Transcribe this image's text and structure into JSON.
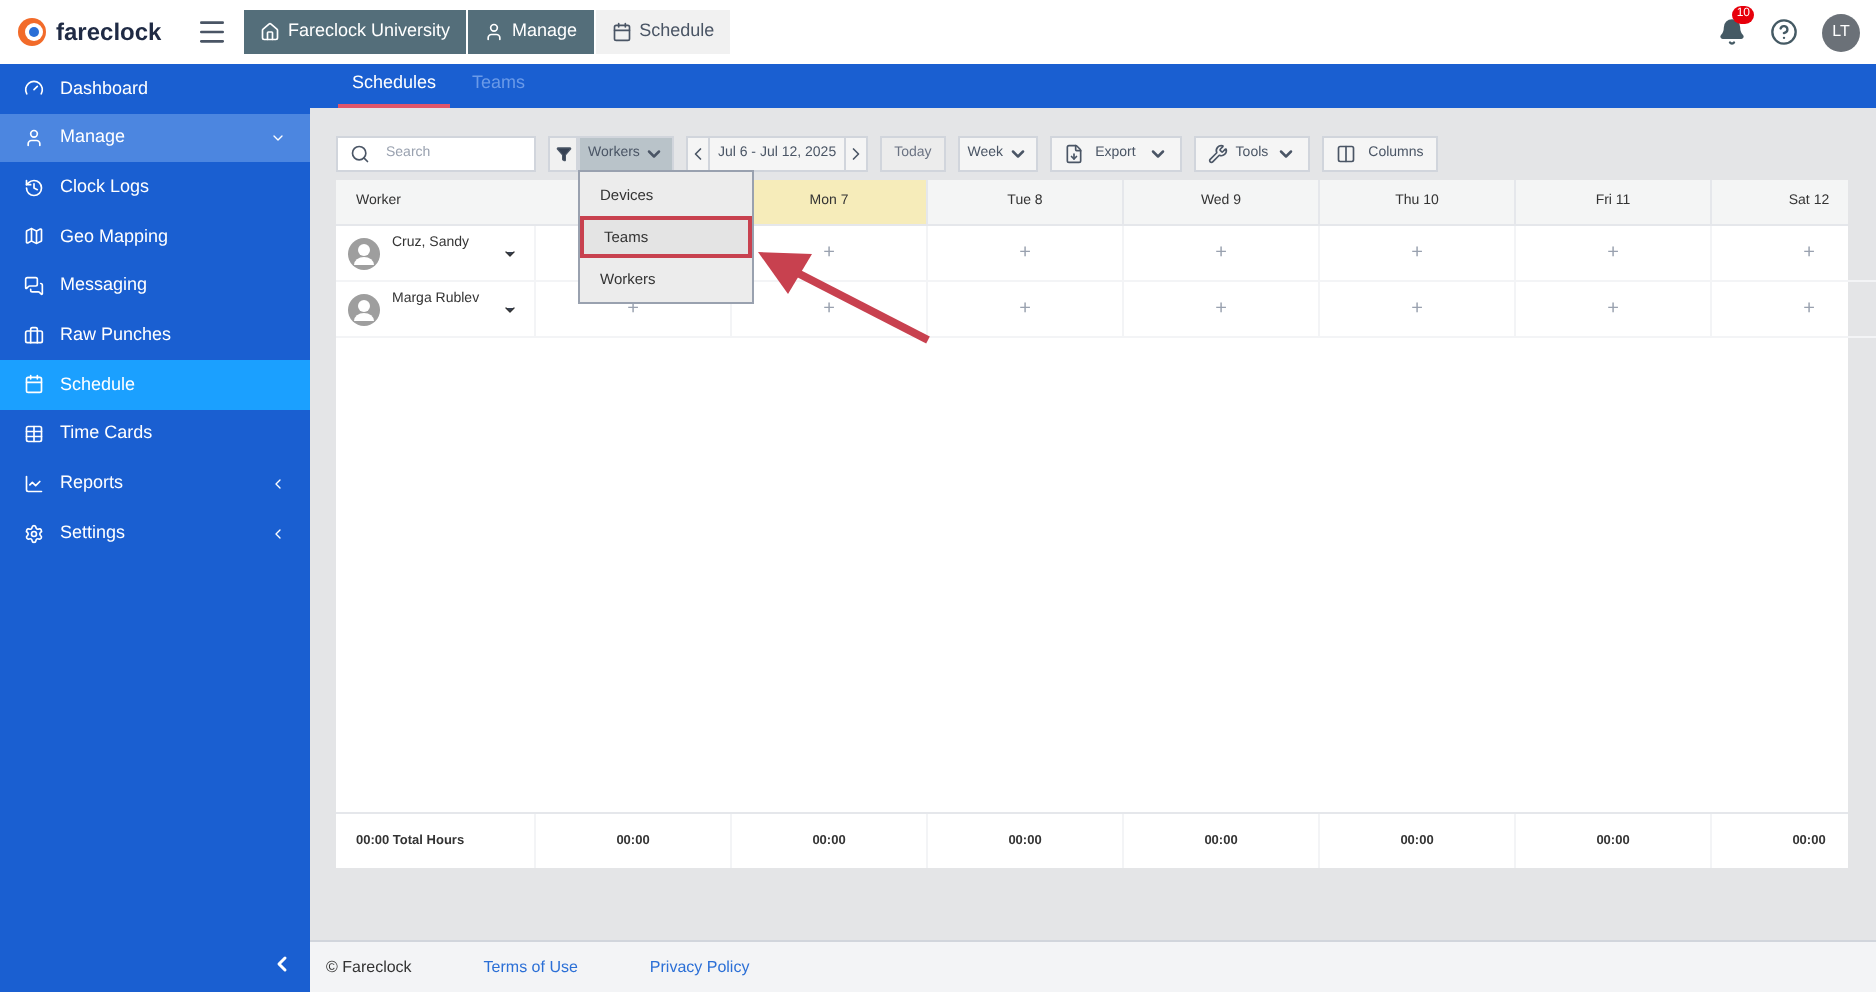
{
  "brand": "fareclock",
  "breadcrumbs": [
    {
      "label": "Fareclock University",
      "kind": "home"
    },
    {
      "label": "Manage",
      "kind": "user"
    },
    {
      "label": "Schedule",
      "kind": "calendar"
    }
  ],
  "notifications": {
    "count": "10"
  },
  "user": {
    "initials": "LT"
  },
  "sidebar": {
    "items": [
      {
        "label": "Dashboard",
        "kind": "link",
        "selected": false
      },
      {
        "label": "Manage",
        "kind": "submenu",
        "selected": false,
        "expanded": true
      },
      {
        "label": "Clock Logs",
        "kind": "link",
        "selected": false
      },
      {
        "label": "Geo Mapping",
        "kind": "link",
        "selected": false
      },
      {
        "label": "Messaging",
        "kind": "link",
        "selected": false
      },
      {
        "label": "Raw Punches",
        "kind": "link",
        "selected": false
      },
      {
        "label": "Schedule",
        "kind": "link",
        "selected": true
      },
      {
        "label": "Time Cards",
        "kind": "link",
        "selected": false
      },
      {
        "label": "Reports",
        "kind": "submenu",
        "selected": false,
        "expanded": false
      },
      {
        "label": "Settings",
        "kind": "submenu",
        "selected": false,
        "expanded": false
      }
    ]
  },
  "tabs": [
    {
      "label": "Schedules",
      "selected": true
    },
    {
      "label": "Teams",
      "selected": false
    }
  ],
  "toolbar": {
    "search_placeholder": "Search",
    "group_by": "Workers",
    "date_range": "Jul 6 - Jul 12, 2025",
    "today": "Today",
    "view": "Week",
    "export": "Export",
    "tools": "Tools",
    "columns": "Columns"
  },
  "group_menu": {
    "items": [
      {
        "label": "Devices",
        "selected": false
      },
      {
        "label": "Teams",
        "selected": true
      },
      {
        "label": "Workers",
        "selected": false
      }
    ]
  },
  "table": {
    "worker_header": "Worker",
    "days": [
      {
        "label": "Mon 7",
        "today": true
      },
      {
        "label": "Tue 8",
        "today": false
      },
      {
        "label": "Wed 9",
        "today": false
      },
      {
        "label": "Thu 10",
        "today": false
      },
      {
        "label": "Fri 11",
        "today": false
      },
      {
        "label": "Sat 12",
        "today": false
      }
    ],
    "rows": [
      {
        "name": "Cruz, Sandy",
        "cells": [
          "",
          "+",
          "+",
          "+",
          "+",
          "+",
          "+"
        ]
      },
      {
        "name": "Marga Rublev",
        "cells": [
          "+",
          "+",
          "+",
          "+",
          "+",
          "+",
          "+"
        ]
      }
    ],
    "totals": {
      "label": "00:00 Total Hours",
      "values": [
        "00:00",
        "00:00",
        "00:00",
        "00:00",
        "00:00",
        "00:00",
        "00:00"
      ]
    }
  },
  "footer": {
    "copyright": "© Fareclock",
    "links": [
      "Terms of Use",
      "Privacy Policy"
    ]
  }
}
